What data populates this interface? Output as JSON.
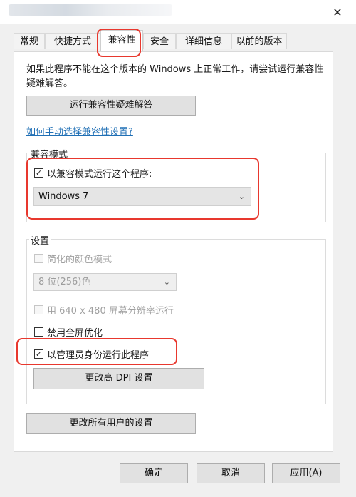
{
  "window": {
    "close_glyph": "✕"
  },
  "tabs": [
    "常规",
    "快捷方式",
    "兼容性",
    "安全",
    "详细信息",
    "以前的版本"
  ],
  "active_tab": "兼容性",
  "description": "如果此程序不能在这个版本的 Windows 上正常工作，请尝试运行兼容性疑难解答。",
  "troubleshoot_button": "运行兼容性疑难解答",
  "manual_link": "如何手动选择兼容性设置?",
  "compat_mode": {
    "group_label": "兼容模式",
    "checkbox_label": "以兼容模式运行这个程序:",
    "checked": true,
    "selected_os": "Windows 7"
  },
  "settings": {
    "group_label": "设置",
    "reduced_color_label": "简化的颜色模式",
    "color_select": "8 位(256)色",
    "resolution_label": "用 640 x 480 屏幕分辨率运行",
    "fullscreen_label": "禁用全屏优化",
    "admin_label": "以管理员身份运行此程序",
    "admin_checked": true,
    "dpi_button": "更改高 DPI 设置"
  },
  "all_users_button": "更改所有用户的设置",
  "buttons": {
    "ok": "确定",
    "cancel": "取消",
    "apply": "应用(A)"
  },
  "annotation_color": "#e8382e",
  "link_color": "#1f6fb5"
}
